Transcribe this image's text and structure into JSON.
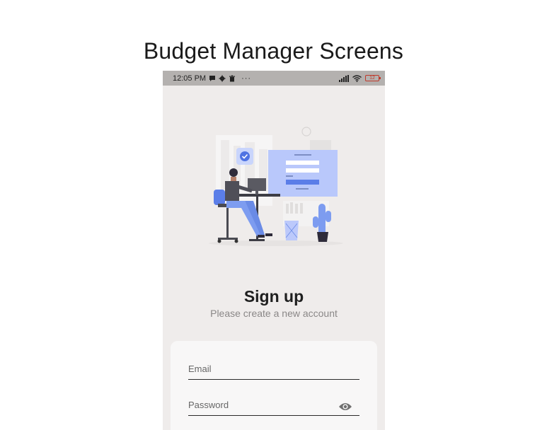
{
  "page_title": "Budget Manager Screens",
  "status_bar": {
    "time": "12:05 PM",
    "more": "···",
    "battery": "12"
  },
  "auth": {
    "title": "Sign up",
    "subtitle": "Please create a new account"
  },
  "form": {
    "email_placeholder": "Email",
    "password_placeholder": "Password"
  },
  "colors": {
    "accent": "#7d9cf0",
    "panel": "#b9c8fb",
    "background": "#efeceb"
  }
}
